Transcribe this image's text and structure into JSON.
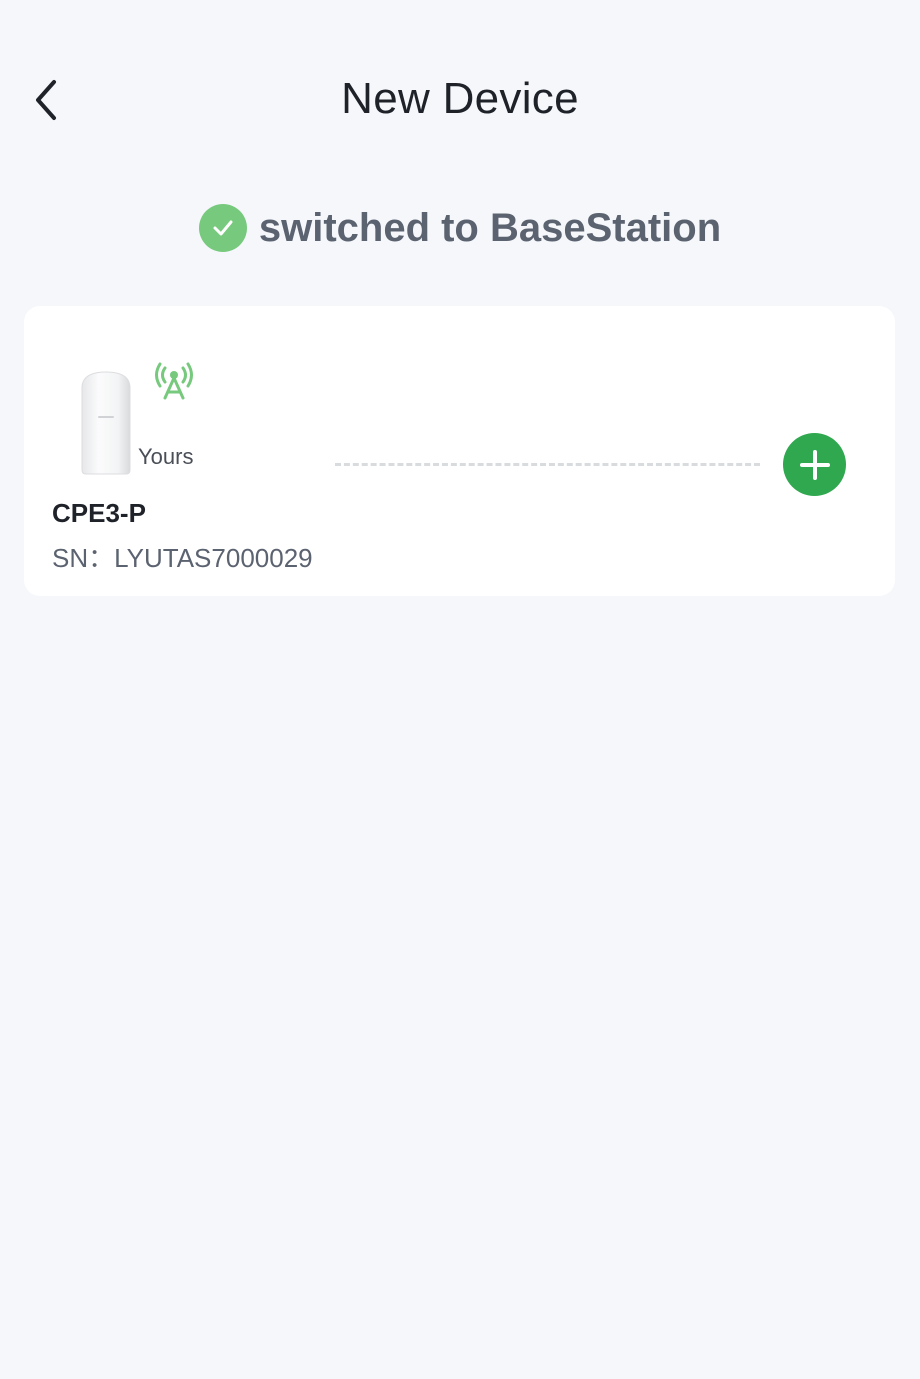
{
  "header": {
    "title": "New Device",
    "back_icon": "chevron-left-icon"
  },
  "status": {
    "icon": "check-circle-icon",
    "text": "switched to BaseStation",
    "color": "#77c97d"
  },
  "device_card": {
    "image": "cpe-device-image",
    "signal_icon": "signal-tower-icon",
    "owner_label": "Yours",
    "name": "CPE3-P",
    "serial": "SN：LYUTAS7000029",
    "add_icon": "plus-icon",
    "add_color": "#2fa84f"
  }
}
